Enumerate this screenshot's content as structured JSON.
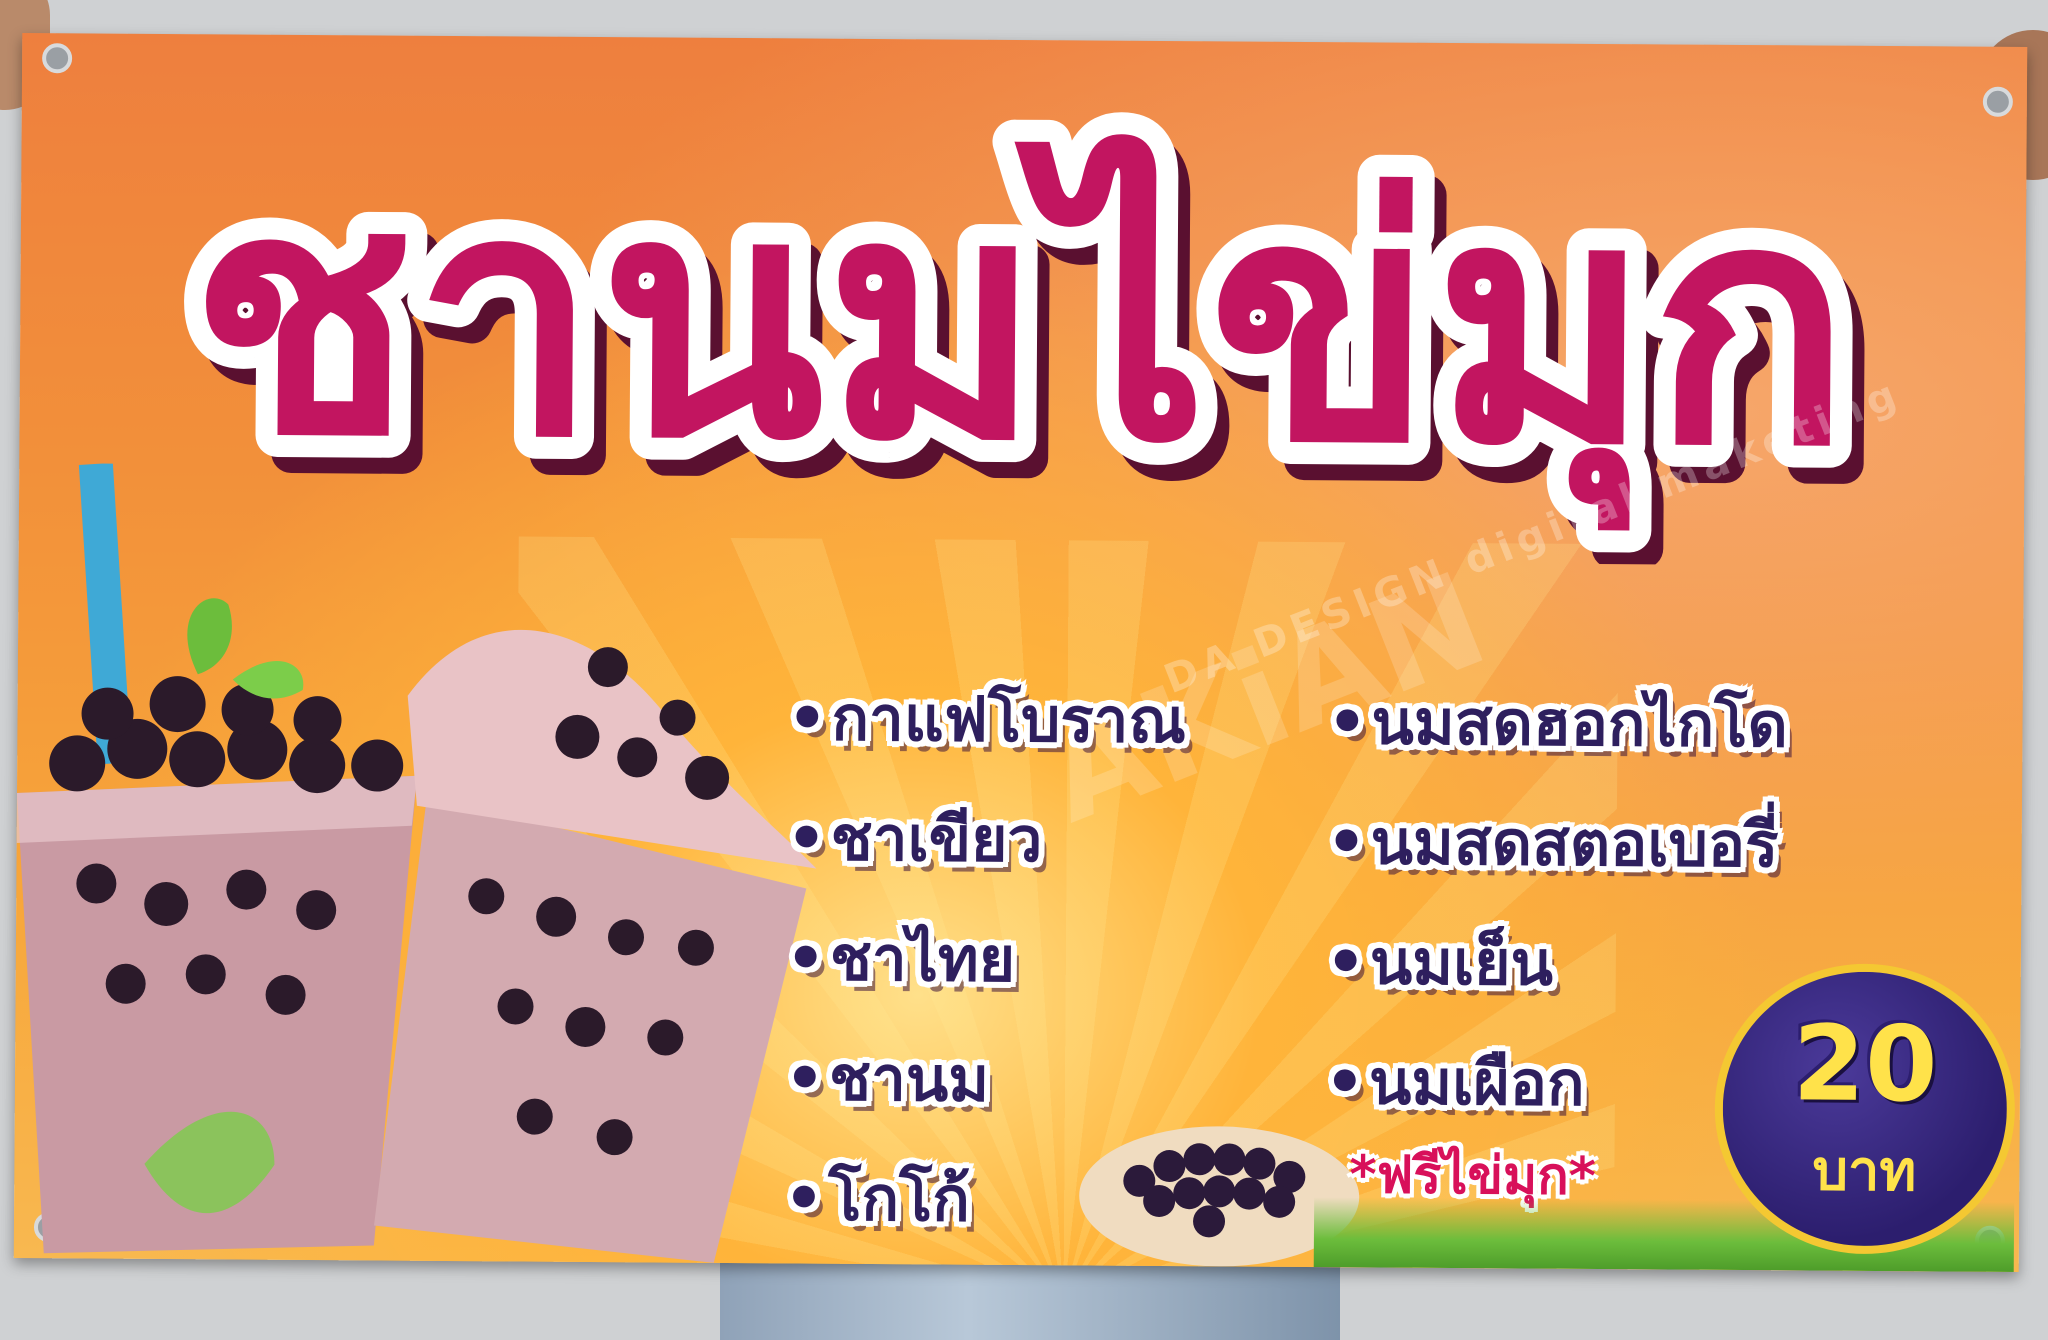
{
  "banner": {
    "title": "ชานมไข่มุก",
    "menu_left": [
      "กาแฟโบราณ",
      "ชาเขียว",
      "ชาไทย",
      "ชานม",
      "โกโก้"
    ],
    "menu_right": [
      "นมสดฮอกไกโด",
      "นมสดสตอเบอรี่",
      "นมเย็น",
      "นมเผือก"
    ],
    "bullet": "•",
    "free_note": "*ฟรีไข่มุก*",
    "price": "20",
    "price_unit": "บาท",
    "watermark": "AKiAN",
    "watermark_sub": "DA DESIGN  digital maketing",
    "colors": {
      "title_magenta": "#c21560",
      "menu_text": "#2e1f5e",
      "price_yellow": "#ffe24a",
      "price_circle": "#2c1e6e",
      "background_orange": "#f2903a"
    }
  }
}
